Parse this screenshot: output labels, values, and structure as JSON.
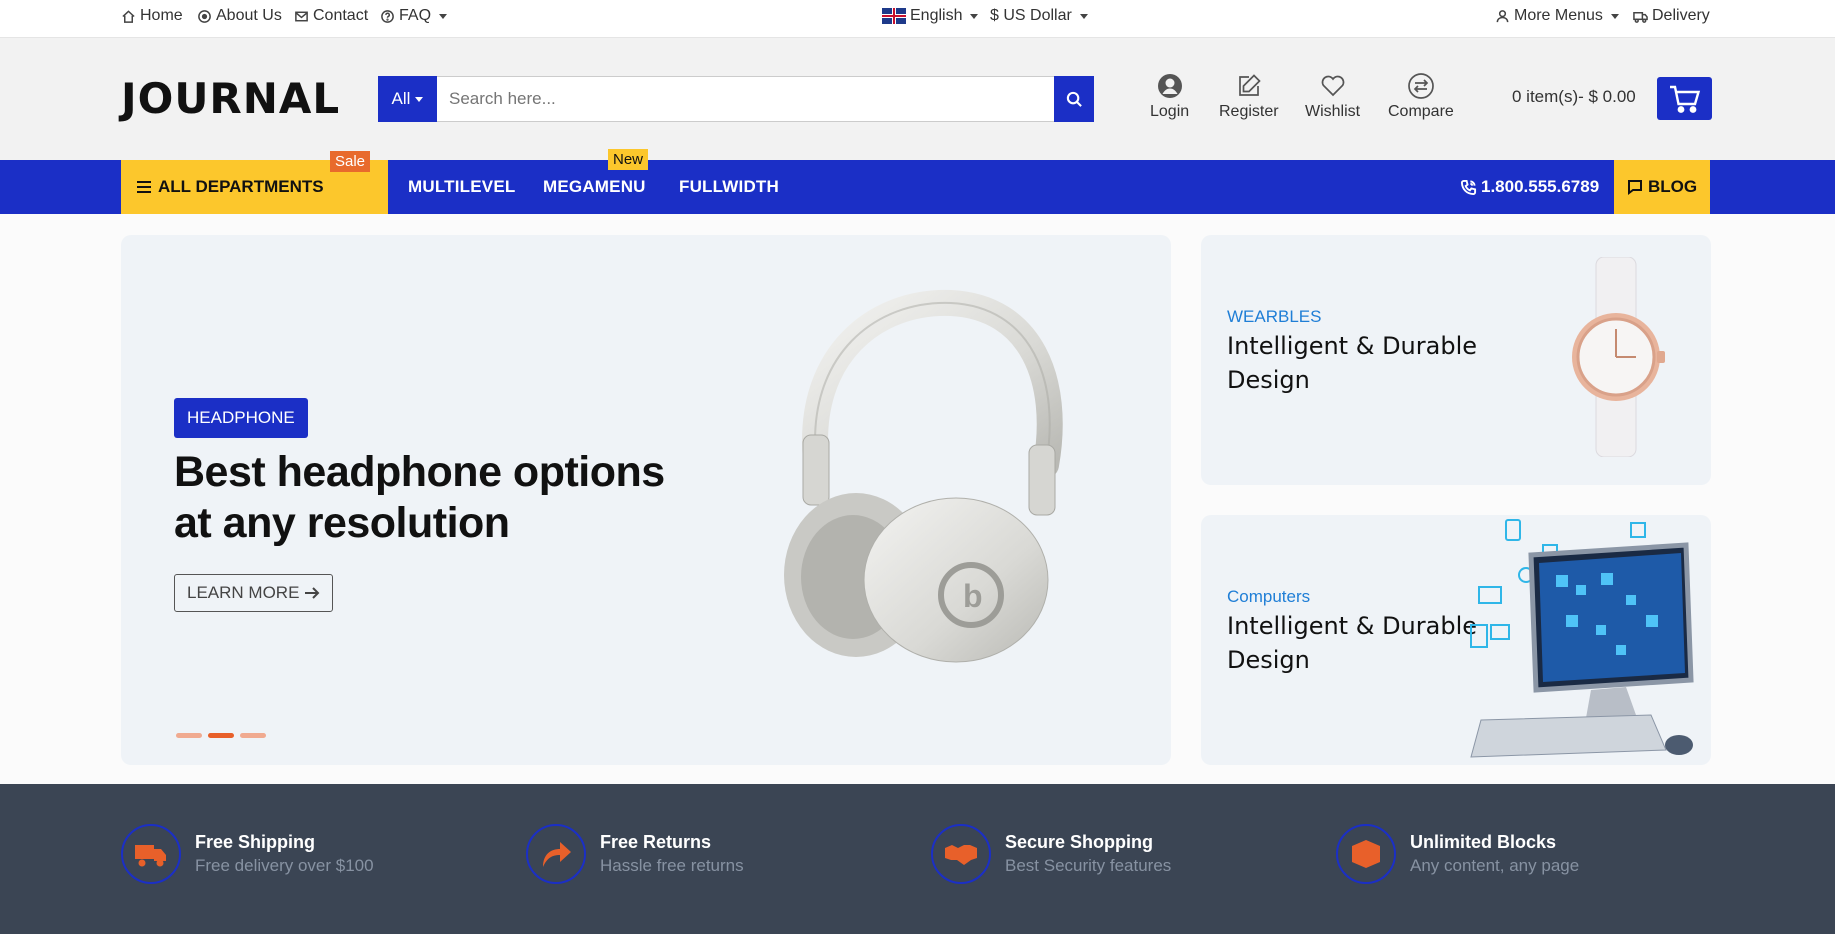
{
  "topbar": {
    "home": "Home",
    "about": "About Us",
    "contact": "Contact",
    "faq": "FAQ",
    "language": "English",
    "currency": "$ US Dollar",
    "more_menus": "More Menus",
    "delivery": "Delivery"
  },
  "header": {
    "logo": "JOURNAL",
    "search_category": "All",
    "search_placeholder": "Search here...",
    "login": "Login",
    "register": "Register",
    "wishlist": "Wishlist",
    "compare": "Compare",
    "cart": "0 item(s)- $ 0.00"
  },
  "nav": {
    "departments": "ALL DEPARTMENTS",
    "sale_badge": "Sale",
    "multilevel": "MULTILEVEL",
    "megamenu": "MEGAMENU",
    "new_badge": "New",
    "fullwidth": "FULLWIDTH",
    "phone": "1.800.555.6789",
    "blog": "BLOG"
  },
  "hero": {
    "tag": "HEADPHONE",
    "headline": "Best headphone options at any resolution",
    "button": "LEARN MORE",
    "slides": 3,
    "active_slide": 2
  },
  "side_cards": [
    {
      "category": "WEARBLES",
      "title": "Intelligent & Durable Design"
    },
    {
      "category": "Computers",
      "title": "Intelligent & Durable Design"
    }
  ],
  "features": [
    {
      "icon": "truck-icon",
      "title": "Free Shipping",
      "subtitle": "Free delivery over $100"
    },
    {
      "icon": "return-arrow-icon",
      "title": "Free Returns",
      "subtitle": "Hassle free returns"
    },
    {
      "icon": "handshake-icon",
      "title": "Secure Shopping",
      "subtitle": "Best Security features"
    },
    {
      "icon": "box-icon",
      "title": "Unlimited Blocks",
      "subtitle": "Any content, any page"
    }
  ],
  "colors": {
    "primary": "#1b2fc6",
    "accent_yellow": "#fcc72c",
    "accent_orange": "#e86a2c",
    "footer_bg": "#3b4554"
  }
}
